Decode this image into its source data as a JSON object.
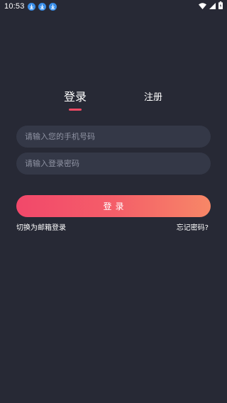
{
  "status_bar": {
    "time": "10:53",
    "notification_icons": [
      "download-icon",
      "download-icon",
      "download-icon"
    ],
    "right_icons": [
      "wifi-icon",
      "signal-icon",
      "battery-icon"
    ]
  },
  "tabs": {
    "login_label": "登录",
    "register_label": "注册",
    "active": "login"
  },
  "form": {
    "phone_placeholder": "请输入您的手机号码",
    "phone_value": "",
    "password_placeholder": "请输入登录密码",
    "password_value": "",
    "login_button_label": "登录"
  },
  "links": {
    "switch_to_email": "切换为邮箱登录",
    "forgot_password": "忘记密码?"
  },
  "colors": {
    "background": "#272935",
    "field_background": "#343847",
    "accent": "#f04a64",
    "button_gradient_start": "#f2486a",
    "button_gradient_end": "#f78767"
  }
}
